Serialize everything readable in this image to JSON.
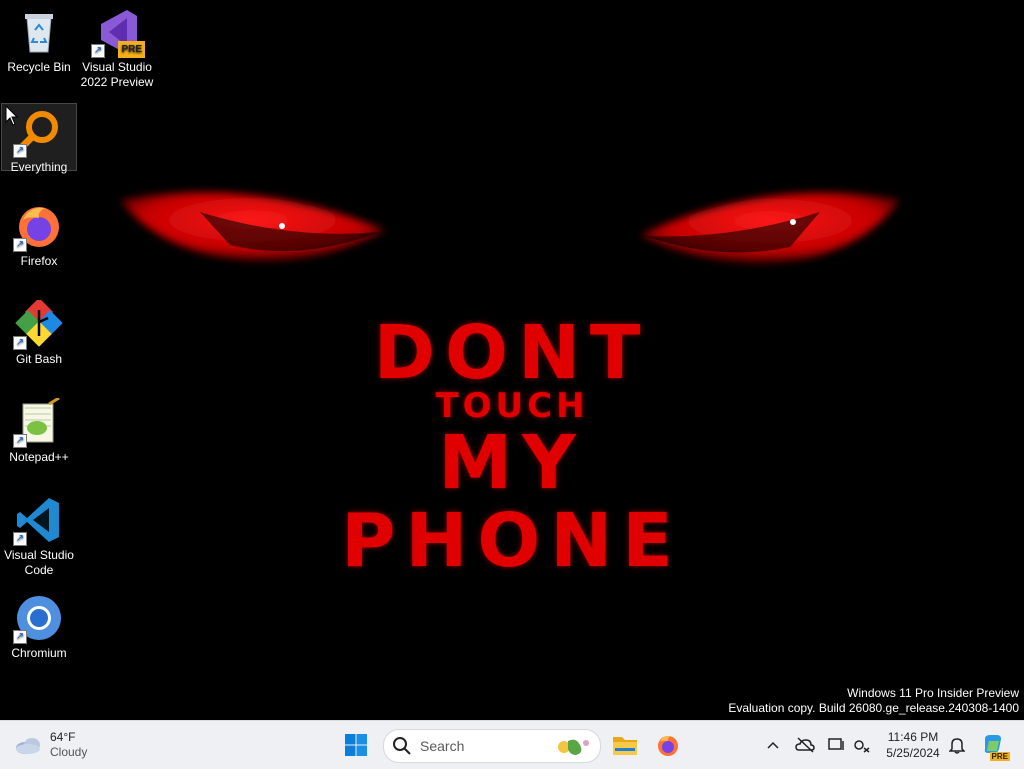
{
  "desktop": {
    "icons": [
      {
        "label": "Recycle Bin",
        "icon": "recycle-bin-icon"
      },
      {
        "label": "Visual Studio\n2022 Preview",
        "label_l1": "Visual Studio",
        "label_l2": "2022 Preview",
        "badge": "PRE",
        "icon": "visual-studio-preview-icon"
      },
      {
        "label": "Everything",
        "icon": "everything-search-icon"
      },
      {
        "label": "Firefox",
        "icon": "firefox-icon"
      },
      {
        "label": "Git Bash",
        "icon": "git-bash-icon"
      },
      {
        "label": "Notepad++",
        "icon": "notepad-plus-plus-icon"
      },
      {
        "label_l1": "Visual Studio",
        "label_l2": "Code",
        "icon": "vscode-icon"
      },
      {
        "label": "Chromium",
        "icon": "chromium-icon"
      }
    ],
    "wallpaper": {
      "line1": "DONT",
      "line2": "TOUCH",
      "line3": "MY",
      "line4": "PHONE",
      "text_color": "#e00000"
    },
    "watermark": {
      "line1": "Windows 11 Pro Insider Preview",
      "line2": "Evaluation copy. Build 26080.ge_release.240308-1400"
    }
  },
  "taskbar": {
    "weather": {
      "temp": "64°F",
      "condition": "Cloudy",
      "icon": "cloud-icon"
    },
    "search_placeholder": "Search",
    "pinned": [
      "windows-start-icon",
      "file-explorer-icon",
      "firefox-icon"
    ],
    "tray_icons": [
      "chevron-up-icon",
      "onedrive-offline-icon",
      "display-icon",
      "network-icon",
      "notification-bell-icon",
      "copilot-icon"
    ],
    "clock": {
      "time": "11:46 PM",
      "date": "5/25/2024"
    },
    "copilot_badge": "PRE"
  }
}
